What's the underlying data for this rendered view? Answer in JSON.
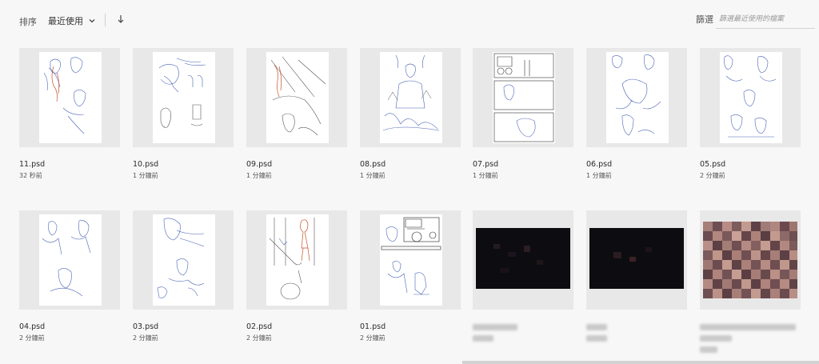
{
  "toolbar": {
    "sort_label": "排序",
    "sort_value": "最近使用",
    "filter_label": "篩選",
    "filter_placeholder": "篩選最近使用的檔案"
  },
  "files": [
    {
      "name": "11.psd",
      "time": "32 秒前"
    },
    {
      "name": "10.psd",
      "time": "1 分鐘前"
    },
    {
      "name": "09.psd",
      "time": "1 分鐘前"
    },
    {
      "name": "08.psd",
      "time": "1 分鐘前"
    },
    {
      "name": "07.psd",
      "time": "1 分鐘前"
    },
    {
      "name": "06.psd",
      "time": "1 分鐘前"
    },
    {
      "name": "05.psd",
      "time": "2 分鐘前"
    },
    {
      "name": "04.psd",
      "time": "2 分鐘前"
    },
    {
      "name": "03.psd",
      "time": "2 分鐘前"
    },
    {
      "name": "02.psd",
      "time": "2 分鐘前"
    },
    {
      "name": "01.psd",
      "time": "2 分鐘前"
    }
  ],
  "colors": {
    "sketch_blue": "#4a63b5",
    "sketch_red": "#c8502a",
    "thumb_bg": "#e8e8e8"
  }
}
